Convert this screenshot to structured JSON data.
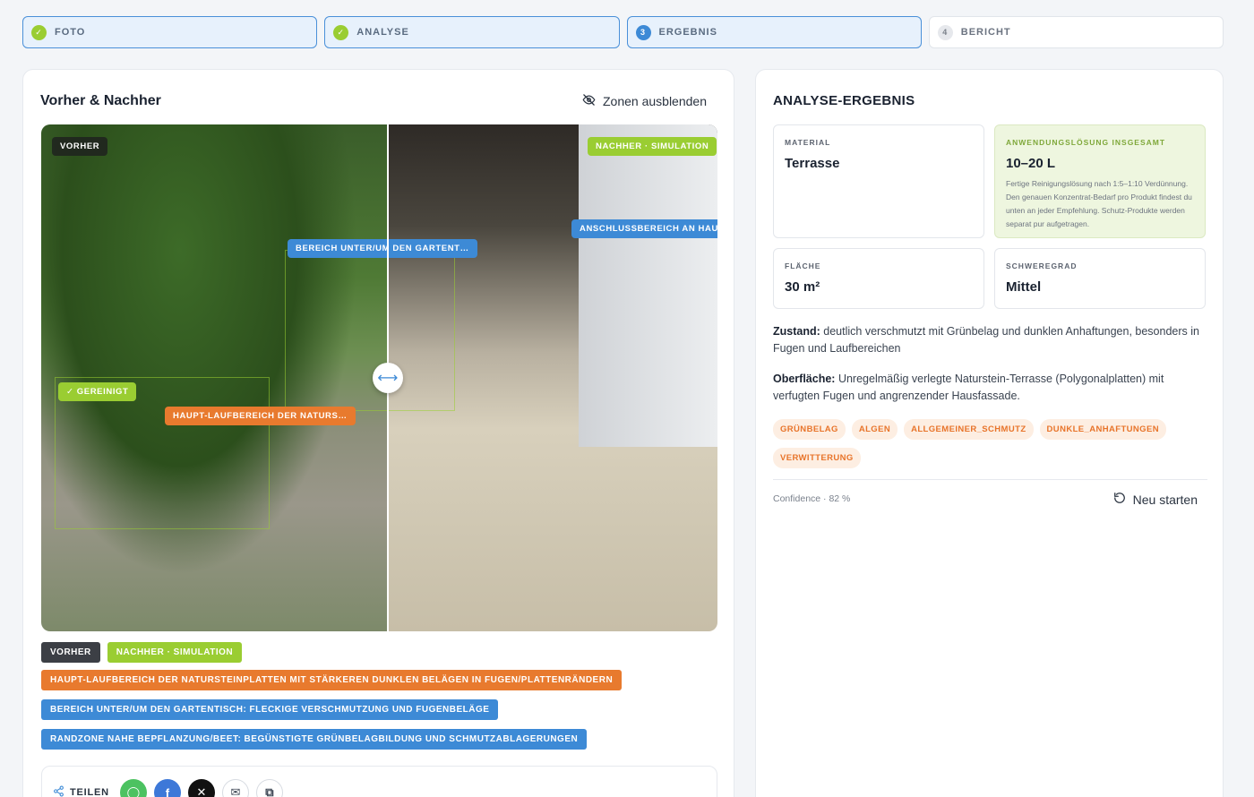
{
  "stepper": [
    {
      "label": "FOTO",
      "status": "done",
      "badge": "✓"
    },
    {
      "label": "ANALYSE",
      "status": "done",
      "badge": "✓"
    },
    {
      "label": "ERGEBNIS",
      "status": "current",
      "badge": "3"
    },
    {
      "label": "BERICHT",
      "status": "todo",
      "badge": "4"
    }
  ],
  "comparison": {
    "title": "Vorher & Nachher",
    "hide_zones_label": "Zonen ausblenden",
    "before_tag": "VORHER",
    "after_tag": "NACHHER · SIMULATION",
    "zone_labels": {
      "table": "BEREICH UNTER/UM DEN GARTENT…",
      "wall": "ANSCHLUSSBEREICH AN HAUSWAN",
      "cleaned": "✓ GEREINIGT",
      "main": "HAUPT-LAUFBEREICH DER NATURS…"
    }
  },
  "legend": {
    "before": "VORHER",
    "after": "NACHHER · SIMULATION",
    "zones": [
      "HAUPT-LAUFBEREICH DER NATURSTEINPLATTEN MIT STÄRKEREN DUNKLEN BELÄGEN IN FUGEN/PLATTENRÄNDERN",
      "BEREICH UNTER/UM DEN GARTENTISCH: FLECKIGE VERSCHMUTZUNG UND FUGENBELÄGE",
      "RANDZONE NAHE BEPFLANZUNG/BEET: BEGÜNSTIGTE GRÜNBELAGBILDUNG UND SCHMUTZABLAGERUNGEN"
    ]
  },
  "share": {
    "label": "TEILEN"
  },
  "result": {
    "title": "ANALYSE-ERGEBNIS",
    "material_label": "MATERIAL",
    "material_value": "Terrasse",
    "solution_label": "ANWENDUNGSLÖSUNG INSGESAMT",
    "solution_value": "10–20 L",
    "solution_note": "Fertige Reinigungslösung nach 1:5–1:10 Verdünnung. Den genauen Konzentrat-Bedarf pro Produkt findest du unten an jeder Empfehlung. Schutz-Produkte werden separat pur aufgetragen.",
    "area_label": "FLÄCHE",
    "area_value": "30 m²",
    "severity_label": "SCHWEREGRAD",
    "severity_value": "Mittel",
    "condition_label": "Zustand:",
    "condition_text": "deutlich verschmutzt mit Grünbelag und dunklen Anhaftungen, besonders in Fugen und Laufbereichen",
    "surface_label": "Oberfläche:",
    "surface_text": "Unregelmäßig verlegte Naturstein-Terrasse (Polygonalplatten) mit verfugten Fugen und angrenzender Hausfassade.",
    "chips": [
      "GRÜNBELAG",
      "ALGEN",
      "ALLGEMEINER_SCHMUTZ",
      "DUNKLE_ANHAFTUNGEN",
      "VERWITTERUNG"
    ],
    "confidence": "Confidence · 82 %",
    "restart_label": "Neu starten"
  }
}
